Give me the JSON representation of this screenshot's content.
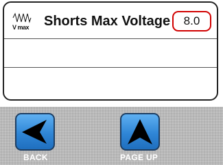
{
  "panel": {
    "title": "Shorts Max Voltage",
    "icon": "vmax-waveform-icon",
    "icon_text": "V max",
    "value": "8.0",
    "value_border_color": "#d10000"
  },
  "toolbar": {
    "back_label": "BACK",
    "back_icon": "left-arrow-icon",
    "page_up_label": "PAGE UP",
    "page_up_icon": "up-arrow-icon",
    "button_color": "#2f86d6"
  }
}
